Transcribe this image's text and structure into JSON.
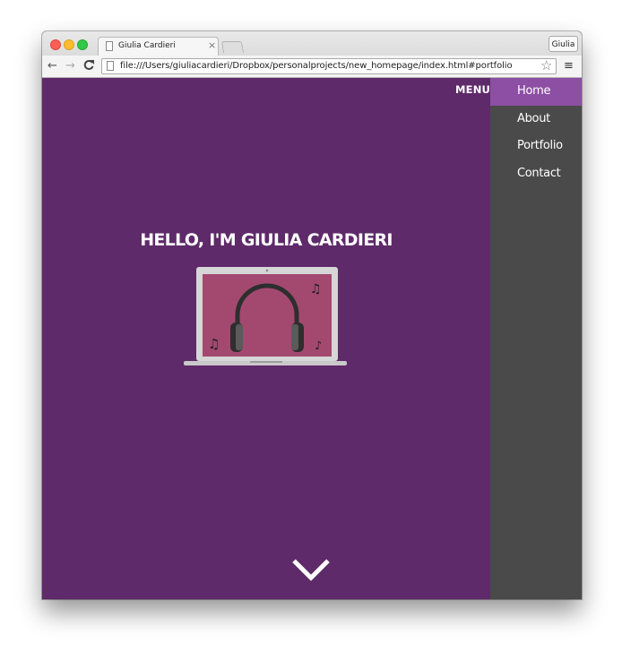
{
  "browser": {
    "tab_title": "Giulia Cardieri",
    "tab_close": "×",
    "profile_name": "Giulia",
    "url": "file:///Users/giuliacardieri/Dropbox/personalprojects/new_homepage/index.html#portfolio",
    "nav": {
      "back": "←",
      "forward": "→",
      "reload": "C",
      "star": "☆",
      "menu": "≡"
    }
  },
  "page": {
    "menu_label": "MENU",
    "hero_title": "HELLO, I'M GIULIA CARDIERI",
    "nav_items": [
      {
        "label": "Home",
        "active": true
      },
      {
        "label": "About",
        "active": false
      },
      {
        "label": "Portfolio",
        "active": false
      },
      {
        "label": "Contact",
        "active": false
      }
    ],
    "icons": {
      "illustration": "laptop-headphones-icon",
      "scroll": "chevron-down-icon"
    }
  },
  "colors": {
    "background": "#5e2a69",
    "sidebar": "#4a4a4a",
    "active_item": "#8c4fa3",
    "screen": "#a34970"
  }
}
